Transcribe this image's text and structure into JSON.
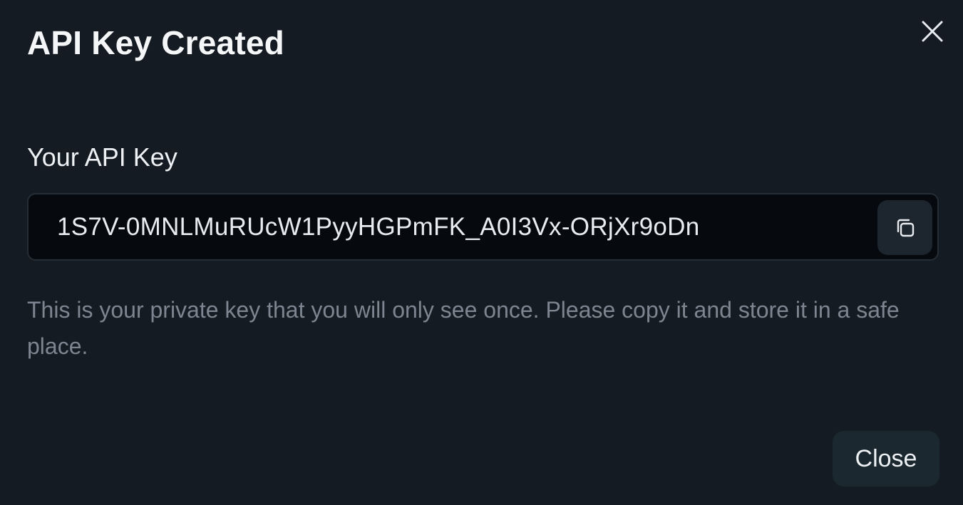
{
  "dialog": {
    "title": "API Key Created",
    "field_label": "Your API Key",
    "api_key": "1S7V-0MNLMuRUcW1PyyHGPmFK_A0I3Vx-ORjXr9oDn",
    "helper_text": "This is your private key that you will only see once. Please copy it and store it in a safe place.",
    "close_button_label": "Close",
    "icons": {
      "close": "close-icon",
      "copy": "copy-icon"
    }
  },
  "colors": {
    "background": "#151b23",
    "key_field_background": "#06090d",
    "button_background": "#1b2830",
    "muted_text": "#7d8690",
    "primary_text": "#f4f6f8"
  }
}
